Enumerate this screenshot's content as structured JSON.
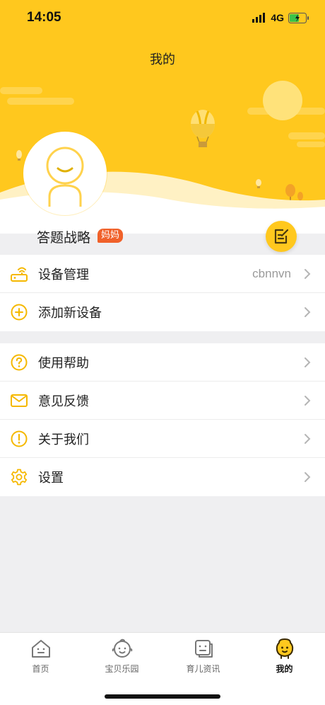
{
  "status_bar": {
    "time": "14:05",
    "network": "4G"
  },
  "header": {
    "title": "我的"
  },
  "profile": {
    "name": "答题战略",
    "badge": "妈妈"
  },
  "menu_groups": [
    {
      "items": [
        {
          "icon": "router-icon",
          "label": "设备管理",
          "value": "cbnnvn"
        },
        {
          "icon": "add-circle-icon",
          "label": "添加新设备",
          "value": ""
        }
      ]
    },
    {
      "items": [
        {
          "icon": "help-icon",
          "label": "使用帮助",
          "value": ""
        },
        {
          "icon": "mail-icon",
          "label": "意见反馈",
          "value": ""
        },
        {
          "icon": "info-icon",
          "label": "关于我们",
          "value": ""
        },
        {
          "icon": "gear-icon",
          "label": "设置",
          "value": ""
        }
      ]
    }
  ],
  "tabs": [
    {
      "icon": "home-icon",
      "label": "首页",
      "active": false
    },
    {
      "icon": "baby-face-icon",
      "label": "宝贝乐园",
      "active": false
    },
    {
      "icon": "news-icon",
      "label": "育儿资讯",
      "active": false
    },
    {
      "icon": "mascot-icon",
      "label": "我的",
      "active": true
    }
  ],
  "colors": {
    "brand": "#ffc81e",
    "badge": "#f0612a",
    "icon": "#f5b800"
  }
}
